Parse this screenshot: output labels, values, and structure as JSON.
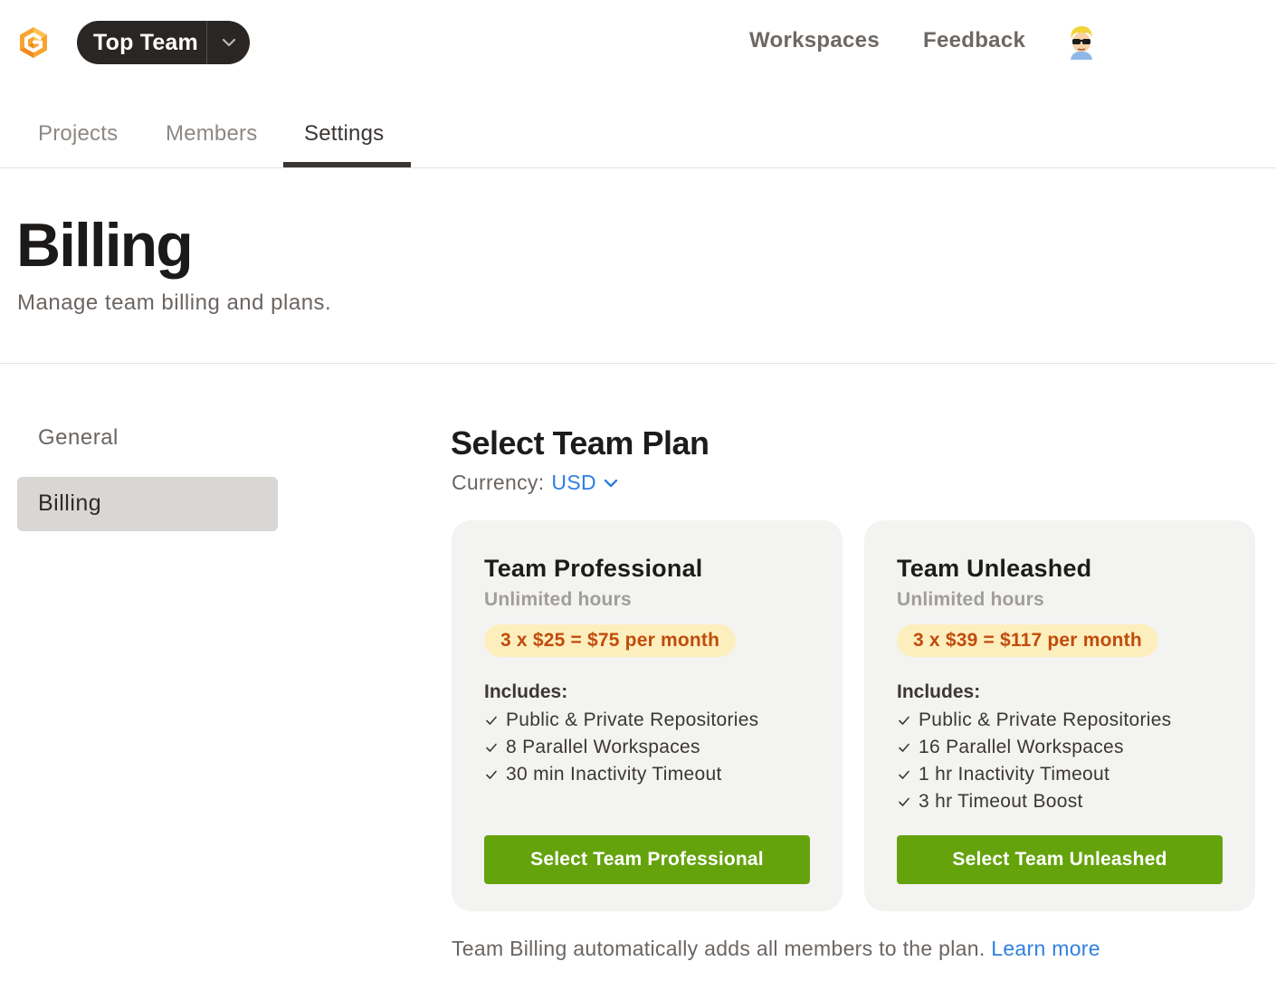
{
  "header": {
    "team_name": "Top Team",
    "nav": [
      "Workspaces",
      "Feedback"
    ]
  },
  "tabs": [
    {
      "label": "Projects"
    },
    {
      "label": "Members"
    },
    {
      "label": "Settings",
      "active": true
    }
  ],
  "page": {
    "title": "Billing",
    "subtitle": "Manage team billing and plans."
  },
  "sidebar": {
    "items": [
      {
        "label": "General"
      },
      {
        "label": "Billing",
        "active": true
      }
    ]
  },
  "plans_section": {
    "heading": "Select Team Plan",
    "currency_label": "Currency:",
    "currency_value": "USD"
  },
  "plans": [
    {
      "name": "Team Professional",
      "hours": "Unlimited hours",
      "price": "3 x $25 = $75 per month",
      "includes_label": "Includes:",
      "features": [
        "Public & Private Repositories",
        "8 Parallel Workspaces",
        "30 min Inactivity Timeout"
      ],
      "button": "Select Team Professional"
    },
    {
      "name": "Team Unleashed",
      "hours": "Unlimited hours",
      "price": "3 x $39 = $117 per month",
      "includes_label": "Includes:",
      "features": [
        "Public & Private Repositories",
        "16 Parallel Workspaces",
        "1 hr Inactivity Timeout",
        "3 hr Timeout Boost"
      ],
      "button": "Select Team Unleashed"
    }
  ],
  "footnote": {
    "text": "Team Billing automatically adds all members to the plan.",
    "link": "Learn more"
  },
  "colors": {
    "accent_orange": "#f59e0b",
    "button_green": "#65a30d",
    "link_blue": "#2f7fe0",
    "price_bg": "#fdefbd",
    "price_text": "#c14b0c"
  }
}
